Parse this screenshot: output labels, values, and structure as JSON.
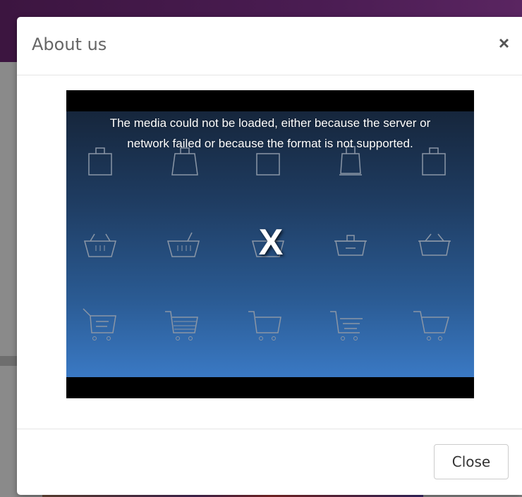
{
  "modal": {
    "title": "About us",
    "close_icon": "close-icon",
    "close_glyph": "×"
  },
  "video": {
    "error_message": "The media could not be loaded, either because the server or network failed or because the format is not supported.",
    "error_glyph": "X",
    "background_icons": [
      "shopping-bag-icon",
      "shopping-basket-icon",
      "shopping-cart-icon"
    ]
  },
  "footer": {
    "close_label": "Close"
  },
  "colors": {
    "header_bg": "#4a1c52",
    "video_top": "#16263c",
    "video_bottom": "#3a79c4"
  }
}
